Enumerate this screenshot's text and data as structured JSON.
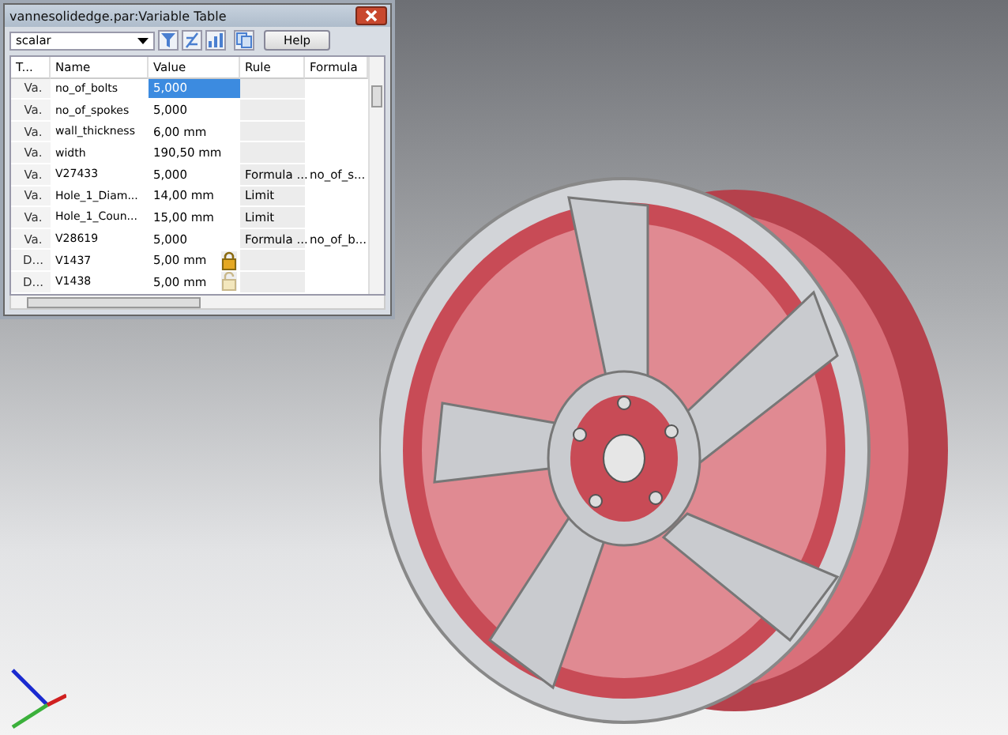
{
  "window": {
    "title": "vannesolidedge.par:Variable Table"
  },
  "toolbar": {
    "filter": "scalar",
    "help_button": "Help"
  },
  "table": {
    "columns": [
      "T...",
      "Name",
      "Value",
      "Rule",
      "Formula"
    ],
    "rows": [
      {
        "kind": "plain",
        "type": "Va.",
        "name": "no_of_bolts",
        "value": "5,000",
        "selected": true
      },
      {
        "kind": "plain",
        "type": "Va.",
        "name": "no_of_spokes",
        "value": "5,000",
        "selected": false
      },
      {
        "kind": "plain",
        "type": "Va.",
        "name": "wall_thickness",
        "value": "6,00 mm",
        "selected": false
      },
      {
        "kind": "plain",
        "type": "Va.",
        "name": "width",
        "value": "190,50 mm",
        "selected": false
      },
      {
        "kind": "plain",
        "type": "Va.",
        "name": "V27433",
        "value": "5,000",
        "rule": "Formula ...",
        "formula": "no_of_s...",
        "selected": false
      },
      {
        "kind": "plain",
        "type": "Va.",
        "name": "Hole_1_Diam...",
        "value": "14,00 mm",
        "rule": "Limit",
        "selected": false
      },
      {
        "kind": "plain",
        "type": "Va.",
        "name": "Hole_1_Coun...",
        "value": "15,00 mm",
        "rule": "Limit",
        "selected": false
      },
      {
        "kind": "plain",
        "type": "Va.",
        "name": "V28619",
        "value": "5,000",
        "rule": "Formula ...",
        "formula": "no_of_b...",
        "selected": false
      },
      {
        "kind": "locked",
        "type": "D...",
        "name": "V1437",
        "value": "5,00 mm",
        "selected": false
      },
      {
        "kind": "unlocked",
        "type": "D...",
        "name": "V1438",
        "value": "5,00 mm",
        "selected": false
      }
    ]
  }
}
